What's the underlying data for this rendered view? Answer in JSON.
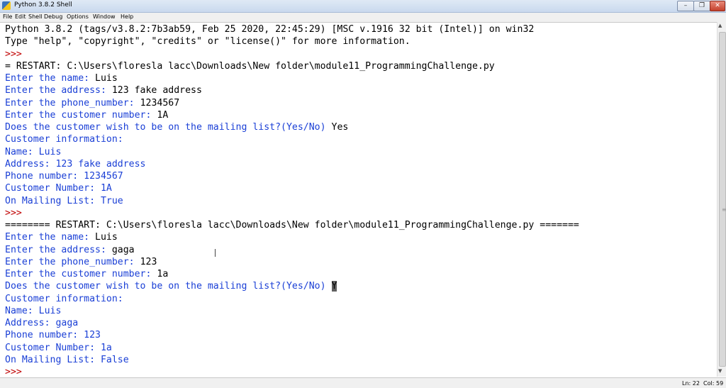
{
  "window": {
    "title": "Python 3.8.2 Shell",
    "buttons": {
      "minimize": "–",
      "maximize": "❐",
      "close": "✕"
    }
  },
  "menu": [
    "File",
    "Edit",
    "Shell",
    "Debug",
    "Options",
    "Window",
    "Help"
  ],
  "shell": {
    "lines": [
      {
        "text": "Python 3.8.2 (tags/v3.8.2:7b3ab59, Feb 25 2020, 22:45:29) [MSC v.1916 32 bit (Intel)] on win32",
        "kind": "plain"
      },
      {
        "text": "Type \"help\", \"copyright\", \"credits\" or \"license()\" for more information.",
        "kind": "plain"
      },
      {
        "text": ">>>",
        "kind": "prompt"
      },
      {
        "text": "= RESTART: C:\\Users\\floresla lacc\\Downloads\\New folder\\module11_ProgrammingChallenge.py",
        "kind": "plain"
      },
      {
        "text": "Enter the name: ",
        "input": "Luis",
        "kind": "stdout"
      },
      {
        "text": "Enter the address: ",
        "input": "123 fake address",
        "kind": "stdout"
      },
      {
        "text": "Enter the phone_number: ",
        "input": "1234567",
        "kind": "stdout"
      },
      {
        "text": "Enter the customer number: ",
        "input": "1A",
        "kind": "stdout"
      },
      {
        "text": "Does the customer wish to be on the mailing list?(Yes/No) ",
        "input": "Yes",
        "kind": "stdout"
      },
      {
        "text": "Customer information:",
        "kind": "stdout"
      },
      {
        "text": "Name: Luis",
        "kind": "stdout"
      },
      {
        "text": "Address: 123 fake address",
        "kind": "stdout"
      },
      {
        "text": "Phone number: 1234567",
        "kind": "stdout"
      },
      {
        "text": "Customer Number: 1A",
        "kind": "stdout"
      },
      {
        "text": "On Mailing List: True",
        "kind": "stdout"
      },
      {
        "text": ">>>",
        "kind": "prompt"
      },
      {
        "text": "======== RESTART: C:\\Users\\floresla lacc\\Downloads\\New folder\\module11_ProgrammingChallenge.py =======",
        "kind": "plain"
      },
      {
        "text": "Enter the name: ",
        "input": "Luis",
        "kind": "stdout"
      },
      {
        "text": "Enter the address: ",
        "input": "gaga",
        "kind": "stdout"
      },
      {
        "text": "Enter the phone_number: ",
        "input": "123",
        "kind": "stdout"
      },
      {
        "text": "Enter the customer number: ",
        "input": "1a",
        "kind": "stdout"
      },
      {
        "text": "Does the customer wish to be on the mailing list?(Yes/No) ",
        "input": "Y",
        "selected": true,
        "kind": "stdout"
      },
      {
        "text": "Customer information:",
        "kind": "stdout"
      },
      {
        "text": "Name: Luis",
        "kind": "stdout"
      },
      {
        "text": "Address: gaga",
        "kind": "stdout"
      },
      {
        "text": "Phone number: 123",
        "kind": "stdout"
      },
      {
        "text": "Customer Number: 1a",
        "kind": "stdout"
      },
      {
        "text": "On Mailing List: False",
        "kind": "stdout"
      },
      {
        "text": ">>>",
        "kind": "prompt"
      }
    ]
  },
  "status": {
    "line": "Ln: 22",
    "col": "Col: 59"
  },
  "colors": {
    "stdout": "#1a3fd6",
    "prompt": "#c00000",
    "plain": "#000000"
  }
}
